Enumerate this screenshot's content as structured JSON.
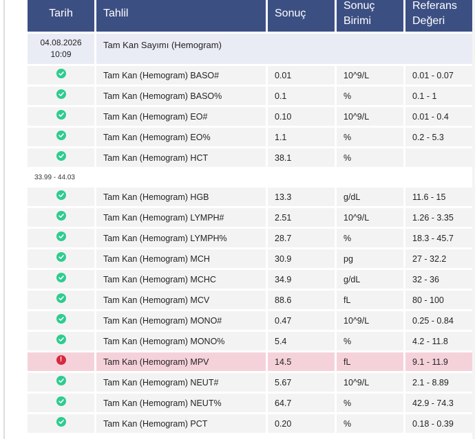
{
  "header": {
    "col_date": "Tarih",
    "col_test": "Tahlil",
    "col_result": "Sonuç",
    "col_unit": "Sonuç\nBirimi",
    "col_ref": "Referans\nDeğeri"
  },
  "group": {
    "date": "04.08.2026\n10:09",
    "name": "Tam Kan Sayımı (Hemogram)"
  },
  "rows_a": [
    {
      "status": "ok",
      "test": "Tam Kan (Hemogram) BASO#",
      "result": "0.01",
      "unit": "10^9/L",
      "ref": "0.01 - 0.07"
    },
    {
      "status": "ok",
      "test": "Tam Kan (Hemogram) BASO%",
      "result": "0.1",
      "unit": "%",
      "ref": "0.1 - 1"
    },
    {
      "status": "ok",
      "test": "Tam Kan (Hemogram) EO#",
      "result": "0.10",
      "unit": "10^9/L",
      "ref": "0.01 - 0.4"
    },
    {
      "status": "ok",
      "test": "Tam Kan (Hemogram) EO%",
      "result": "1.1",
      "unit": "%",
      "ref": "0.2 - 5.3"
    },
    {
      "status": "ok",
      "test": "Tam Kan (Hemogram) HCT",
      "result": "38.1",
      "unit": "%",
      "ref": ""
    }
  ],
  "hct_ref_note": "33.99 - 44.03",
  "rows_b": [
    {
      "status": "ok",
      "test": "Tam Kan (Hemogram) HGB",
      "result": "13.3",
      "unit": "g/dL",
      "ref": "11.6 - 15"
    },
    {
      "status": "ok",
      "test": "Tam Kan (Hemogram) LYMPH#",
      "result": "2.51",
      "unit": "10^9/L",
      "ref": "1.26 - 3.35"
    },
    {
      "status": "ok",
      "test": "Tam Kan (Hemogram) LYMPH%",
      "result": "28.7",
      "unit": "%",
      "ref": "18.3 - 45.7"
    },
    {
      "status": "ok",
      "test": "Tam Kan (Hemogram) MCH",
      "result": "30.9",
      "unit": "pg",
      "ref": "27 - 32.2"
    },
    {
      "status": "ok",
      "test": "Tam Kan (Hemogram) MCHC",
      "result": "34.9",
      "unit": "g/dL",
      "ref": "32 - 36"
    },
    {
      "status": "ok",
      "test": "Tam Kan (Hemogram) MCV",
      "result": "88.6",
      "unit": "fL",
      "ref": "80 - 100"
    },
    {
      "status": "ok",
      "test": "Tam Kan (Hemogram) MONO#",
      "result": "0.47",
      "unit": "10^9/L",
      "ref": "0.25 - 0.84"
    },
    {
      "status": "ok",
      "test": "Tam Kan (Hemogram) MONO%",
      "result": "5.4",
      "unit": "%",
      "ref": "4.2 - 11.8"
    },
    {
      "status": "err",
      "test": "Tam Kan (Hemogram) MPV",
      "result": "14.5",
      "unit": "fL",
      "ref": "9.1 - 11.9"
    },
    {
      "status": "ok",
      "test": "Tam Kan (Hemogram) NEUT#",
      "result": "5.67",
      "unit": "10^9/L",
      "ref": "2.1 - 8.89"
    },
    {
      "status": "ok",
      "test": "Tam Kan (Hemogram) NEUT%",
      "result": "64.7",
      "unit": "%",
      "ref": "42.9 - 74.3"
    },
    {
      "status": "ok",
      "test": "Tam Kan (Hemogram) PCT",
      "result": "0.20",
      "unit": "%",
      "ref": "0.18 - 0.39"
    }
  ],
  "icons": {
    "ok": "check-circle-icon",
    "err": "alert-circle-icon"
  },
  "colors": {
    "header": "#3c4f83",
    "ok": "#2ecc8f",
    "err": "#d8293f",
    "abnormal_row": "#f5d2da"
  }
}
